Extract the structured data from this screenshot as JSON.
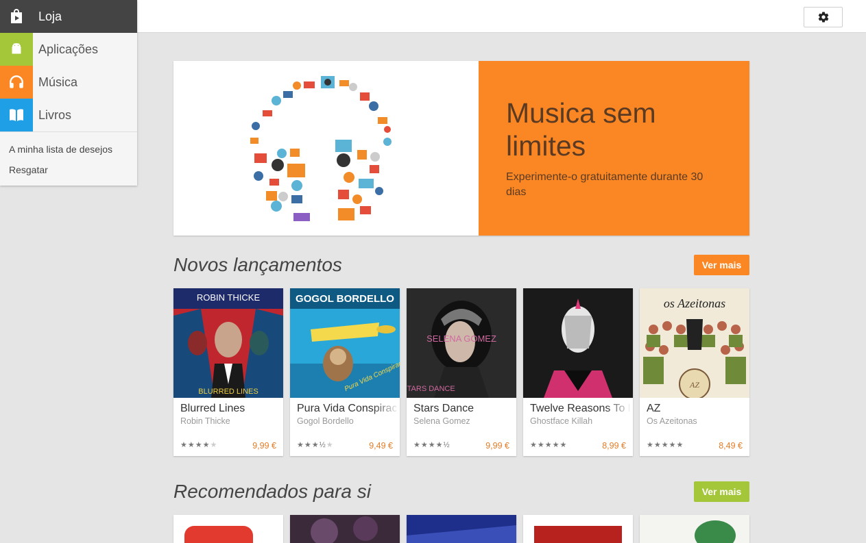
{
  "sidebar": {
    "items": [
      {
        "label": "Loja",
        "icon": "shopping-bag-icon",
        "color": "#444444"
      },
      {
        "label": "Aplicações",
        "icon": "android-icon",
        "color": "#a4c639"
      },
      {
        "label": "Música",
        "icon": "headphones-icon",
        "color": "#fb8724"
      },
      {
        "label": "Livros",
        "icon": "book-icon",
        "color": "#1e9fe6"
      }
    ],
    "links": [
      "A minha lista de desejos",
      "Resgatar"
    ]
  },
  "topbar": {
    "settings_icon": "gear-icon"
  },
  "banner": {
    "title": "Musica sem limites",
    "subtitle": "Experimente-o gratuitamente durante 30 dias",
    "accent": "#fb8724"
  },
  "sections": {
    "new_releases": {
      "title": "Novos lançamentos",
      "more_label": "Ver mais",
      "button_color": "#fb8724"
    },
    "recommended": {
      "title": "Recomendados para si",
      "more_label": "Ver mais",
      "button_color": "#a4c639"
    }
  },
  "albums": [
    {
      "title": "Blurred Lines",
      "artist": "Robin Thicke",
      "price": "9,99 €",
      "rating": 4,
      "cover_text_top": "ROBIN THICKE",
      "cover_text_bottom": "BLURRED LINES"
    },
    {
      "title": "Pura Vida Conspiracy",
      "artist": "Gogol Bordello",
      "price": "9,49 €",
      "rating": 3.5,
      "cover_text_top": "GOGOL BORDELLO",
      "cover_text_bottom": "Pura Vida Conspiracy"
    },
    {
      "title": "Stars Dance",
      "artist": "Selena Gomez",
      "price": "9,99 €",
      "rating": 4.5,
      "cover_text_top": "SELENA GOMEZ",
      "cover_text_bottom": "STARS DANCE"
    },
    {
      "title": "Twelve Reasons To Die",
      "artist": "Ghostface Killah",
      "price": "8,99 €",
      "rating": 5,
      "cover_text_top": "",
      "cover_text_bottom": ""
    },
    {
      "title": "AZ",
      "artist": "Os Azeitonas",
      "price": "8,49 €",
      "rating": 5,
      "cover_text_top": "os Azeitonas",
      "cover_text_bottom": "AZ"
    }
  ]
}
